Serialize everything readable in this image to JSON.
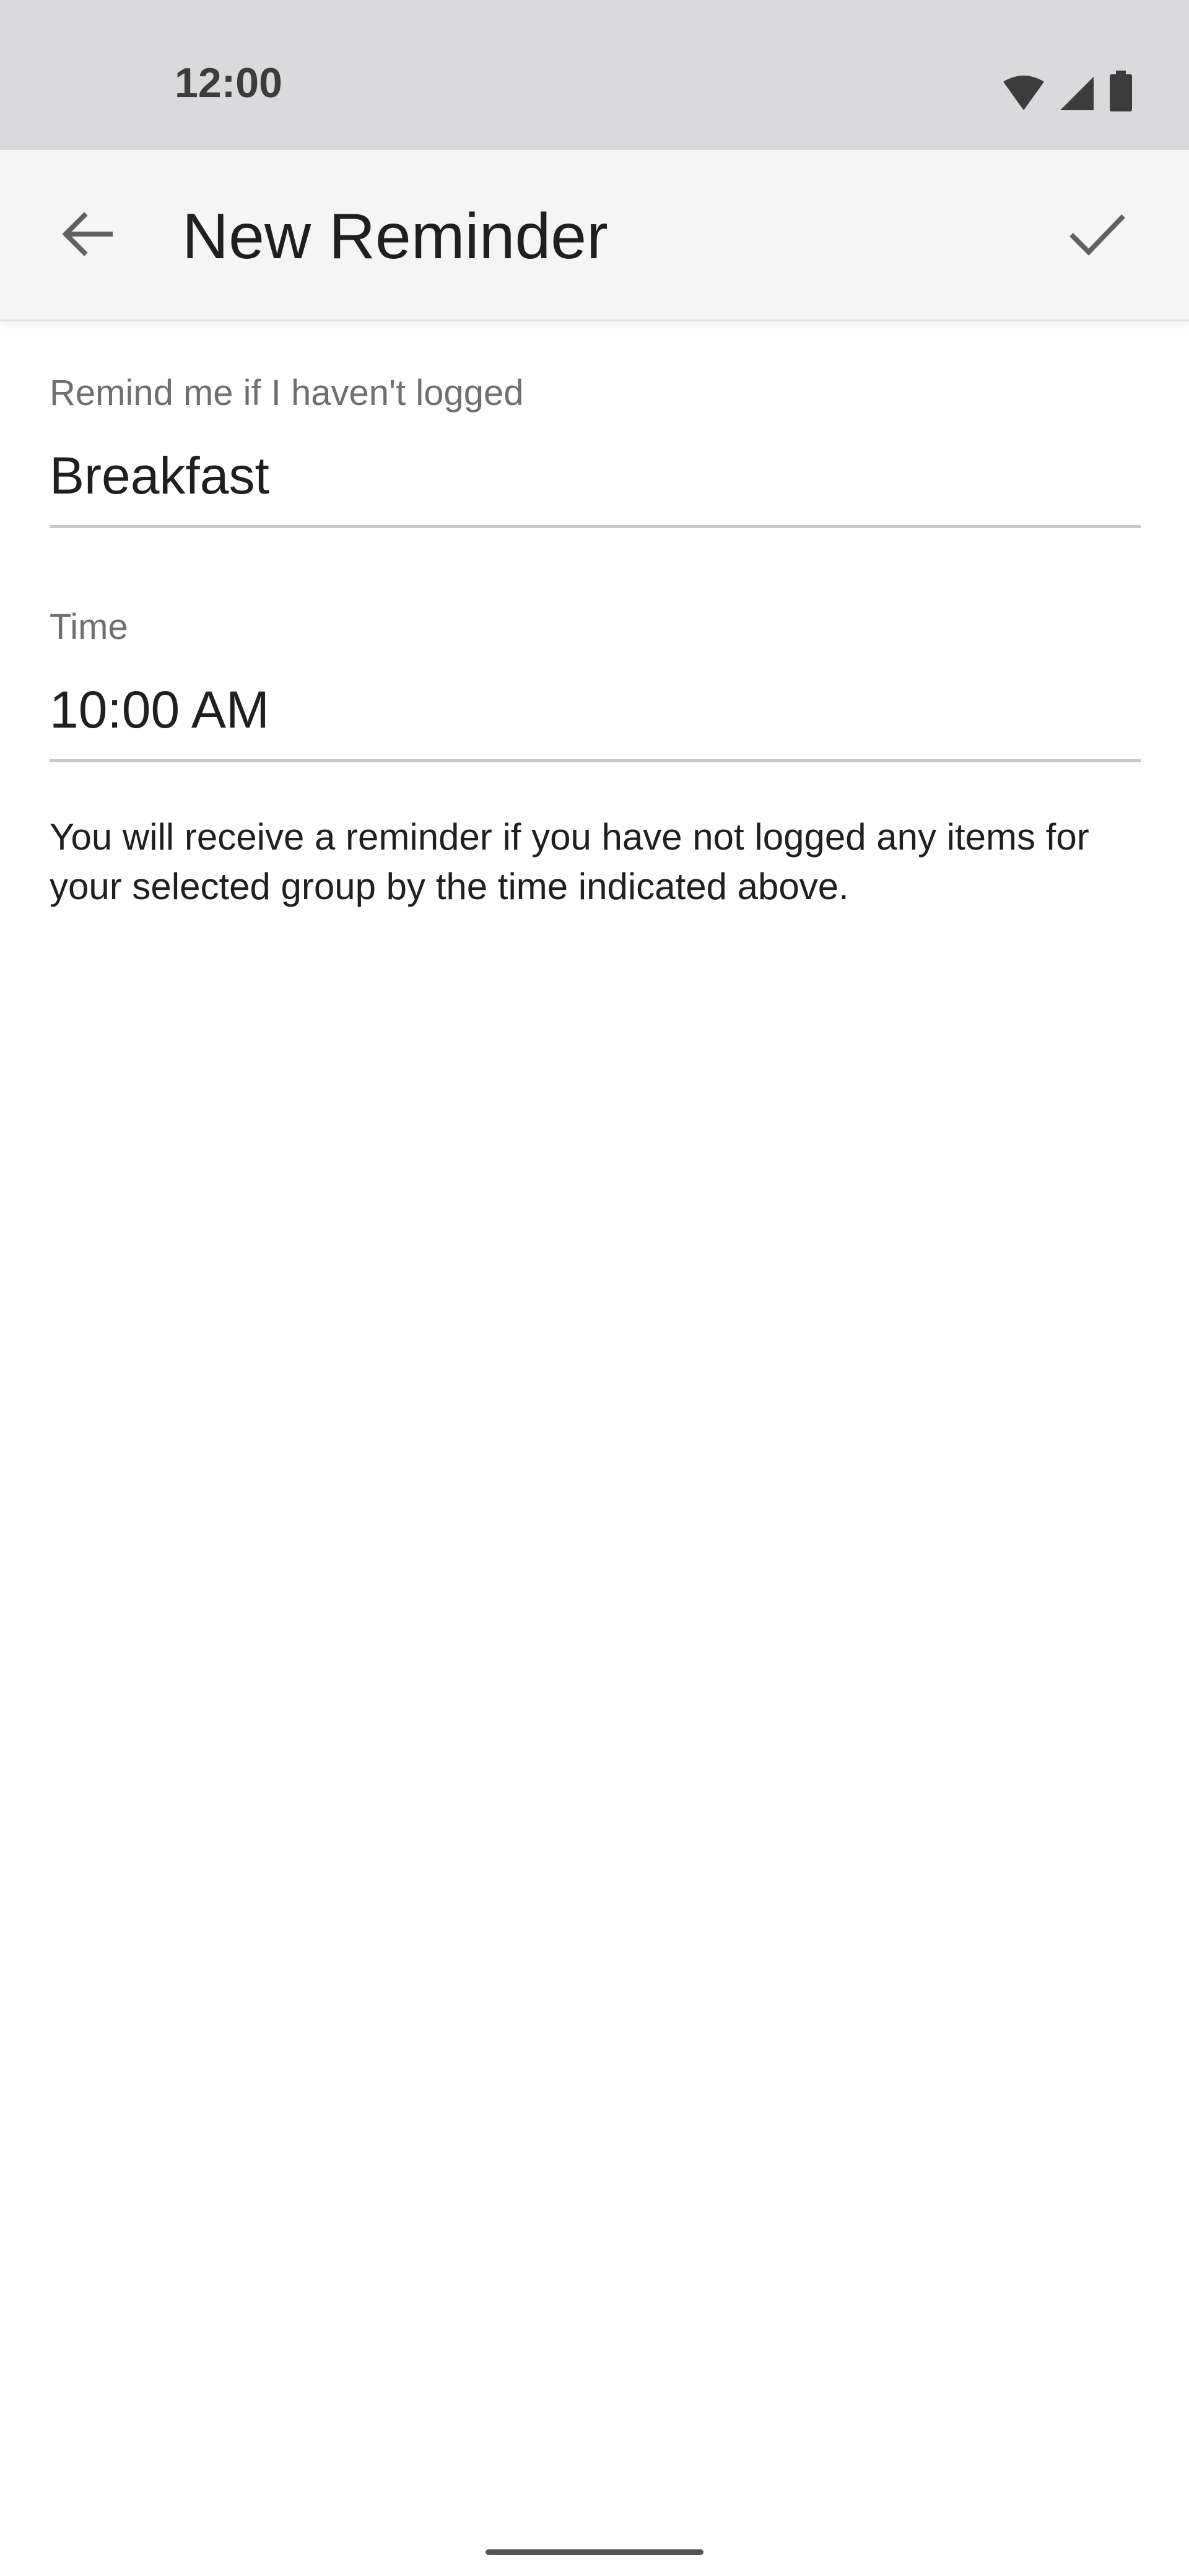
{
  "status_bar": {
    "time": "12:00",
    "icons": [
      "wifi-icon",
      "cellular-signal-icon",
      "battery-icon"
    ]
  },
  "app_bar": {
    "title": "New Reminder",
    "back_icon": "arrow-left-icon",
    "confirm_icon": "checkmark-icon"
  },
  "form": {
    "reminder_field": {
      "label": "Remind me if I haven't logged",
      "value": "Breakfast"
    },
    "time_field": {
      "label": "Time",
      "value": "10:00 AM"
    },
    "helper_text": "You will receive a reminder if you have not logged any items for your selected group by the time indicated above."
  },
  "colors": {
    "status_bar_bg": "#dadadd",
    "app_bar_bg": "#f5f5f5",
    "label_gray": "#6f6f6f",
    "text_dark": "#1f1f1f"
  }
}
